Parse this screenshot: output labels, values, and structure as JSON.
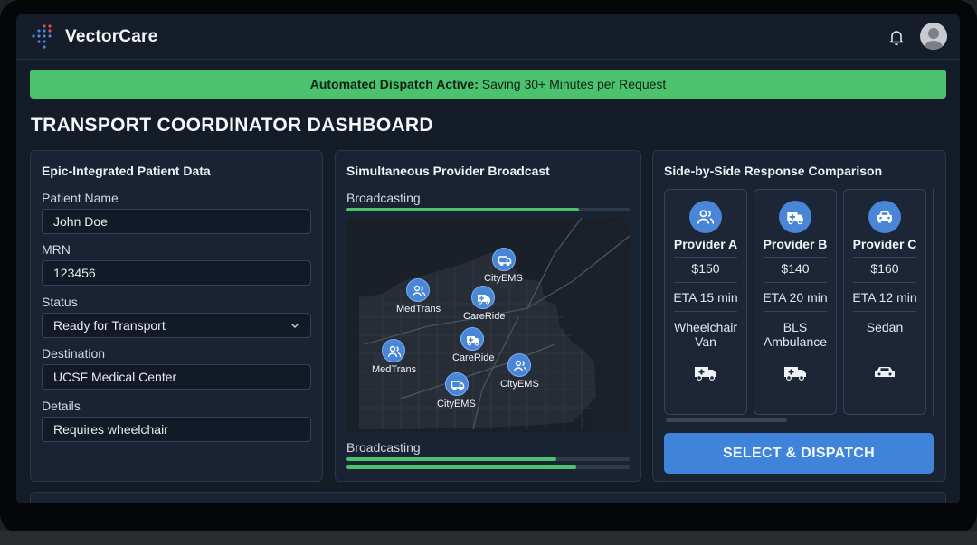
{
  "app": {
    "brand": "VectorCare"
  },
  "banner": {
    "strong": "Automated Dispatch Active:",
    "text": " Saving 30+ Minutes per Request",
    "color": "#4cc26f"
  },
  "page": {
    "title": "TRANSPORT COORDINATOR DASHBOARD"
  },
  "patient": {
    "title": "Epic-Integrated Patient Data",
    "fields": [
      {
        "label": "Patient Name",
        "value": "John Doe"
      },
      {
        "label": "MRN",
        "value": "123456"
      },
      {
        "label": "Status",
        "value": "Ready for Transport"
      },
      {
        "label": "Destination",
        "value": "UCSF Medical Center"
      },
      {
        "label": "Details",
        "value": "Requires wheelchair"
      }
    ]
  },
  "broadcast": {
    "title": "Simultaneous Provider Broadcast",
    "top_label": "Broadcasting",
    "top_progress": 0.82,
    "bottom_label": "Broadcasting",
    "bottom_progress": [
      0.74,
      0.81
    ],
    "map_pins": [
      {
        "label": "CityEMS",
        "icon": "van-icon"
      },
      {
        "label": "MedTrans",
        "icon": "users-icon"
      },
      {
        "label": "CareRide",
        "icon": "ambulance-icon"
      },
      {
        "label": "CareRide",
        "icon": "ambulance-icon"
      },
      {
        "label": "MedTrans",
        "icon": "users-icon"
      },
      {
        "label": "CityEMS",
        "icon": "users-icon"
      },
      {
        "label": "CityEMS",
        "icon": "van-icon"
      }
    ]
  },
  "comparison": {
    "title": "Side-by-Side Response Comparison",
    "providers": [
      {
        "name": "Provider A",
        "price": "$150",
        "eta": "ETA 15 min",
        "vehicle": "Wheelchair Van",
        "icon": "users-icon",
        "vehicle_icon": "ambulance-icon"
      },
      {
        "name": "Provider B",
        "price": "$140",
        "eta": "ETA 20 min",
        "vehicle": "BLS Ambulance",
        "icon": "ambulance-icon",
        "vehicle_icon": "ambulance-icon"
      },
      {
        "name": "Provider C",
        "price": "$160",
        "eta": "ETA 12 min",
        "vehicle": "Sedan",
        "icon": "car-icon",
        "vehicle_icon": "car-icon"
      }
    ],
    "dispatch_label": "SELECT & DISPATCH",
    "accent": "#3f83db"
  }
}
